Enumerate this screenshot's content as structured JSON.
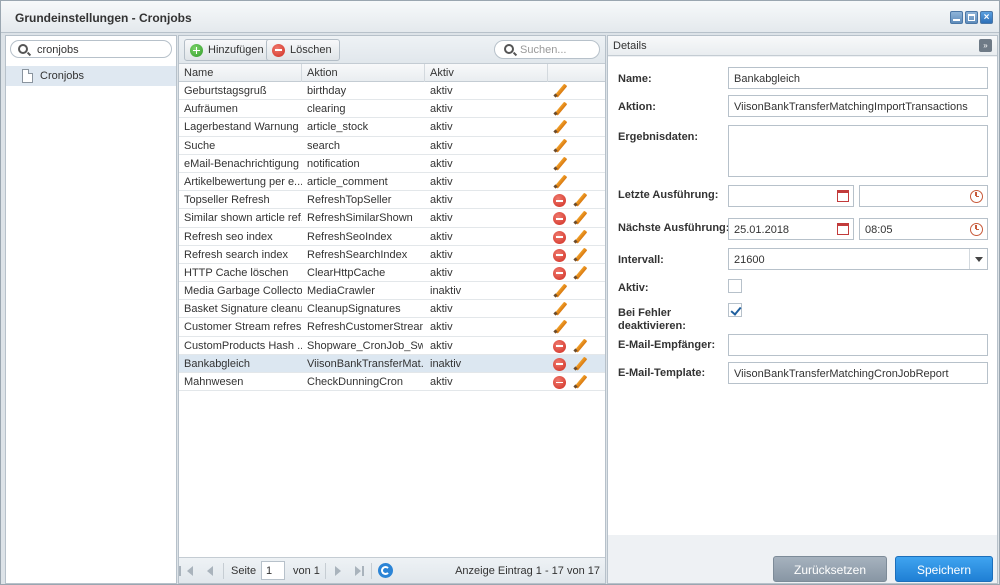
{
  "window": {
    "title": "Grundeinstellungen - Cronjobs"
  },
  "tree": {
    "search_value": "cronjobs",
    "nodes": [
      {
        "label": "Cronjobs"
      }
    ]
  },
  "grid": {
    "toolbar": {
      "add_label": "Hinzufügen",
      "delete_label": "Löschen",
      "search_placeholder": "Suchen..."
    },
    "columns": [
      "Name",
      "Aktion",
      "Aktiv"
    ],
    "rows": [
      {
        "name": "Geburtstagsgruß",
        "action": "birthday",
        "active": "aktiv",
        "deletable": false
      },
      {
        "name": "Aufräumen",
        "action": "clearing",
        "active": "aktiv",
        "deletable": false
      },
      {
        "name": "Lagerbestand Warnung",
        "action": "article_stock",
        "active": "aktiv",
        "deletable": false
      },
      {
        "name": "Suche",
        "action": "search",
        "active": "aktiv",
        "deletable": false
      },
      {
        "name": "eMail-Benachrichtigung",
        "action": "notification",
        "active": "aktiv",
        "deletable": false
      },
      {
        "name": "Artikelbewertung per e...",
        "action": "article_comment",
        "active": "aktiv",
        "deletable": false
      },
      {
        "name": "Topseller Refresh",
        "action": "RefreshTopSeller",
        "active": "aktiv",
        "deletable": true
      },
      {
        "name": "Similar shown article ref...",
        "action": "RefreshSimilarShown",
        "active": "aktiv",
        "deletable": true
      },
      {
        "name": "Refresh seo index",
        "action": "RefreshSeoIndex",
        "active": "aktiv",
        "deletable": true
      },
      {
        "name": "Refresh search index",
        "action": "RefreshSearchIndex",
        "active": "aktiv",
        "deletable": true
      },
      {
        "name": "HTTP Cache löschen",
        "action": "ClearHttpCache",
        "active": "aktiv",
        "deletable": true
      },
      {
        "name": "Media Garbage Collector",
        "action": "MediaCrawler",
        "active": "inaktiv",
        "deletable": false
      },
      {
        "name": "Basket Signature cleanup",
        "action": "CleanupSignatures",
        "active": "aktiv",
        "deletable": false
      },
      {
        "name": "Customer Stream refresh",
        "action": "RefreshCustomerStreams",
        "active": "aktiv",
        "deletable": false
      },
      {
        "name": "CustomProducts Hash ...",
        "action": "Shopware_CronJob_Sw...",
        "active": "aktiv",
        "deletable": true
      },
      {
        "name": "Bankabgleich",
        "action": "ViisonBankTransferMat...",
        "active": "inaktiv",
        "deletable": true,
        "selected": true
      },
      {
        "name": "Mahnwesen",
        "action": "CheckDunningCron",
        "active": "aktiv",
        "deletable": true
      }
    ],
    "pager": {
      "page_label": "Seite",
      "page_value": "1",
      "of_label": "von 1",
      "summary": "Anzeige Eintrag 1 - 17 von 17"
    }
  },
  "details": {
    "header": "Details",
    "collapse_label": "»",
    "fields": {
      "name": {
        "label": "Name:",
        "value": "Bankabgleich"
      },
      "action": {
        "label": "Aktion:",
        "value": "ViisonBankTransferMatchingImportTransactions"
      },
      "result": {
        "label": "Ergebnisdaten:",
        "value": ""
      },
      "last_run": {
        "label": "Letzte Ausführung:",
        "date": "",
        "time": ""
      },
      "next_run": {
        "label": "Nächste Ausführung:",
        "date": "25.01.2018",
        "time": "08:05"
      },
      "interval": {
        "label": "Intervall:",
        "value": "21600"
      },
      "active": {
        "label": "Aktiv:",
        "checked": false
      },
      "disable_on_error": {
        "label": "Bei Fehler deaktivieren:",
        "checked": true
      },
      "email_recipient": {
        "label": "E-Mail-Empfänger:",
        "value": ""
      },
      "email_template": {
        "label": "E-Mail-Template:",
        "value": "ViisonBankTransferMatchingCronJobReport"
      }
    },
    "buttons": {
      "reset_label": "Zurücksetzen",
      "save_label": "Speichern"
    }
  }
}
